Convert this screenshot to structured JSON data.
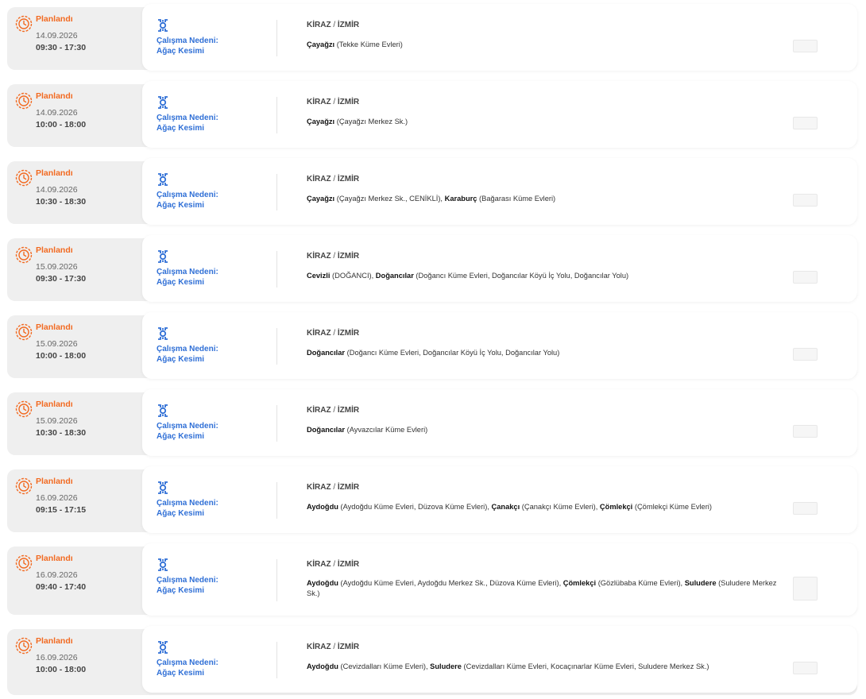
{
  "colors": {
    "status": "#f26a21",
    "reason": "#2f6fd6",
    "background": "#efefef",
    "card": "#ffffff"
  },
  "icons": {
    "status": "planned-clock-icon",
    "reason": "gear-tool-icon"
  },
  "outages": [
    {
      "status": "Planlandı",
      "date": "14.09.2026",
      "time": "09:30 - 17:30",
      "reason_label": "Çalışma Nedeni:",
      "reason": "Ağaç Kesimi",
      "district": "KİRAZ",
      "separator": " / ",
      "province": "İZMİR",
      "areas": [
        {
          "name": "Çayağzı",
          "streets": " (Tekke Küme Evleri)"
        }
      ]
    },
    {
      "status": "Planlandı",
      "date": "14.09.2026",
      "time": "10:00 - 18:00",
      "reason_label": "Çalışma Nedeni:",
      "reason": "Ağaç Kesimi",
      "district": "KİRAZ",
      "separator": " / ",
      "province": "İZMİR",
      "areas": [
        {
          "name": "Çayağzı",
          "streets": " (Çayağzı Merkez Sk.)"
        }
      ]
    },
    {
      "status": "Planlandı",
      "date": "14.09.2026",
      "time": "10:30 - 18:30",
      "reason_label": "Çalışma Nedeni:",
      "reason": "Ağaç Kesimi",
      "district": "KİRAZ",
      "separator": " / ",
      "province": "İZMİR",
      "areas": [
        {
          "name": "Çayağzı",
          "streets": " (Çayağzı Merkez Sk., CENİKLİ), "
        },
        {
          "name": "Karaburç",
          "streets": " (Bağarası Küme Evleri)"
        }
      ]
    },
    {
      "status": "Planlandı",
      "date": "15.09.2026",
      "time": "09:30 - 17:30",
      "reason_label": "Çalışma Nedeni:",
      "reason": "Ağaç Kesimi",
      "district": "KİRAZ",
      "separator": " / ",
      "province": "İZMİR",
      "areas": [
        {
          "name": "Cevizli",
          "streets": " (DOĞANCI), "
        },
        {
          "name": "Doğancılar",
          "streets": " (Doğancı Küme Evleri, Doğancılar Köyü İç Yolu, Doğancılar Yolu)"
        }
      ]
    },
    {
      "status": "Planlandı",
      "date": "15.09.2026",
      "time": "10:00 - 18:00",
      "reason_label": "Çalışma Nedeni:",
      "reason": "Ağaç Kesimi",
      "district": "KİRAZ",
      "separator": " / ",
      "province": "İZMİR",
      "areas": [
        {
          "name": "Doğancılar",
          "streets": " (Doğancı Küme Evleri, Doğancılar Köyü İç Yolu, Doğancılar Yolu)"
        }
      ]
    },
    {
      "status": "Planlandı",
      "date": "15.09.2026",
      "time": "10:30 - 18:30",
      "reason_label": "Çalışma Nedeni:",
      "reason": "Ağaç Kesimi",
      "district": "KİRAZ",
      "separator": " / ",
      "province": "İZMİR",
      "areas": [
        {
          "name": "Doğancılar",
          "streets": " (Ayvazcılar Küme Evleri)"
        }
      ]
    },
    {
      "status": "Planlandı",
      "date": "16.09.2026",
      "time": "09:15 - 17:15",
      "reason_label": "Çalışma Nedeni:",
      "reason": "Ağaç Kesimi",
      "district": "KİRAZ",
      "separator": " / ",
      "province": "İZMİR",
      "areas": [
        {
          "name": "Aydoğdu",
          "streets": " (Aydoğdu Küme Evleri, Düzova Küme Evleri), "
        },
        {
          "name": "Çanakçı",
          "streets": " (Çanakçı Küme Evleri), "
        },
        {
          "name": "Çömlekçi",
          "streets": " (Çömlekçi Küme Evleri)"
        }
      ]
    },
    {
      "status": "Planlandı",
      "date": "16.09.2026",
      "time": "09:40 - 17:40",
      "reason_label": "Çalışma Nedeni:",
      "reason": "Ağaç Kesimi",
      "district": "KİRAZ",
      "separator": " / ",
      "province": "İZMİR",
      "areas": [
        {
          "name": "Aydoğdu",
          "streets": " (Aydoğdu Küme Evleri, Aydoğdu Merkez Sk., Düzova Küme Evleri), "
        },
        {
          "name": "Çömlekçi",
          "streets": " (Gözlübaba Küme Evleri), "
        },
        {
          "name": "Suludere",
          "streets": " (Suludere Merkez Sk.)"
        }
      ]
    },
    {
      "status": "Planlandı",
      "date": "16.09.2026",
      "time": "10:00 - 18:00",
      "reason_label": "Çalışma Nedeni:",
      "reason": "Ağaç Kesimi",
      "district": "KİRAZ",
      "separator": " / ",
      "province": "İZMİR",
      "areas": [
        {
          "name": "Aydoğdu",
          "streets": " (Cevizdalları Küme Evleri), "
        },
        {
          "name": "Suludere",
          "streets": " (Cevizdalları Küme Evleri, Kocaçınarlar Küme Evleri, Suludere Merkez Sk.)"
        }
      ]
    }
  ]
}
